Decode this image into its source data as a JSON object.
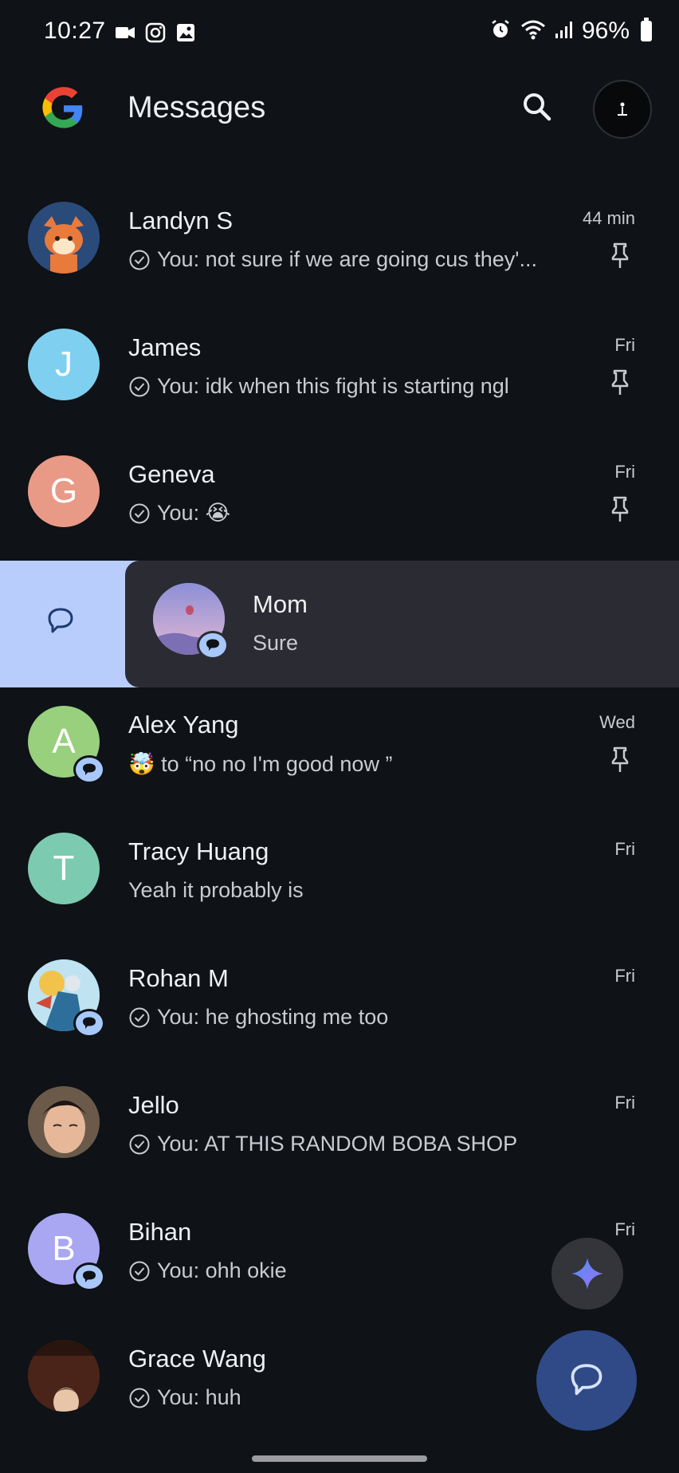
{
  "status_bar": {
    "time": "10:27",
    "battery": "96%"
  },
  "app_bar": {
    "title": "Messages"
  },
  "conversations": [
    {
      "name": "Landyn S",
      "snippet": "You: not sure if we are going cus they'...",
      "time": "44 min",
      "pinned": true,
      "sent_by_me": true,
      "avatar_color": "#2a4a7a"
    },
    {
      "name": "James",
      "snippet": "You: idk when this fight is starting ngl",
      "time": "Fri",
      "pinned": true,
      "sent_by_me": true,
      "initial": "J",
      "avatar_color": "#7fd0f0"
    },
    {
      "name": "Geneva",
      "snippet": "You: 😭",
      "time": "Fri",
      "pinned": true,
      "sent_by_me": true,
      "initial": "G",
      "avatar_color": "#e99a86"
    },
    {
      "name": "Mom",
      "snippet": "Sure",
      "time": "",
      "pinned": false,
      "sent_by_me": false,
      "avatar_color": "#b8b6e2"
    },
    {
      "name": "Alex Yang",
      "snippet": "🤯 to “no no I'm good now ”",
      "time": "Wed",
      "pinned": true,
      "sent_by_me": false,
      "initial": "A",
      "avatar_color": "#98d07e"
    },
    {
      "name": "Tracy Huang",
      "snippet": "Yeah it probably is",
      "time": "Fri",
      "pinned": false,
      "sent_by_me": false,
      "initial": "T",
      "avatar_color": "#7ccbb0"
    },
    {
      "name": "Rohan M",
      "snippet": "You: he ghosting me too",
      "time": "Fri",
      "pinned": false,
      "sent_by_me": true,
      "avatar_color": "#6bb0d8"
    },
    {
      "name": "Jello",
      "snippet": "You: AT THIS RANDOM BOBA SHOP",
      "time": "Fri",
      "pinned": false,
      "sent_by_me": true,
      "avatar_color": "#4a3a30"
    },
    {
      "name": "Bihan",
      "snippet": "You: ohh okie",
      "time": "Fri",
      "pinned": false,
      "sent_by_me": true,
      "initial": "B",
      "avatar_color": "#a9a7f2"
    },
    {
      "name": "Grace Wang",
      "snippet": "You: huh",
      "time": "",
      "pinned": false,
      "sent_by_me": true,
      "avatar_color": "#5a2f22"
    }
  ],
  "colors": {
    "background": "#0f1216",
    "swipe_action": "#b8cdfb",
    "swipe_card": "#2b2c33",
    "compose_fab": "#2f4a87",
    "gemini_fab": "#33353b",
    "badge": "#a8c7fa"
  },
  "icons": [
    "google-logo-icon",
    "search-icon",
    "account-icon",
    "check-circle-icon",
    "pin-icon",
    "chat-bubble-icon",
    "gemini-sparkle-icon"
  ]
}
